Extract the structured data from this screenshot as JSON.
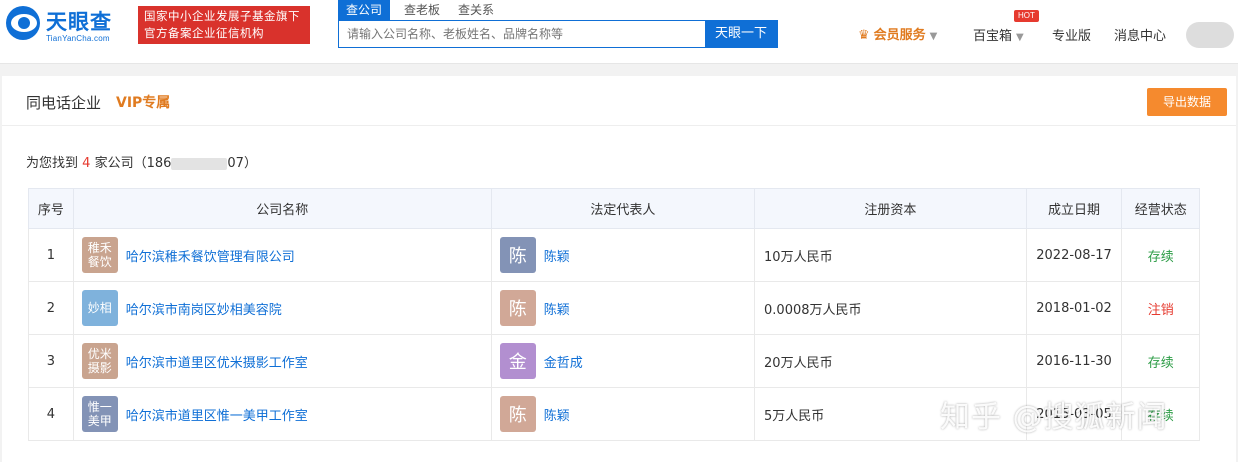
{
  "header": {
    "logo_text": "天眼查",
    "logo_sub": "TianYanCha.com",
    "gov_line1": "国家中小企业发展子基金旗下",
    "gov_line2": "官方备案企业征信机构",
    "search_tabs": [
      {
        "label": "查公司"
      },
      {
        "label": "查老板"
      },
      {
        "label": "查关系"
      }
    ],
    "search_placeholder": "请输入公司名称、老板姓名、品牌名称等",
    "search_button": "天眼一下",
    "vip_service": "会员服务",
    "treasure_box": "百宝箱",
    "hot_badge": "HOT",
    "pro_version": "专业版",
    "message_center": "消息中心"
  },
  "panel": {
    "title": "同电话企业",
    "vip_tag": "VIP专属",
    "export_button": "导出数据",
    "result_prefix": "为您找到",
    "result_count": "4",
    "result_suffix": "家公司（186",
    "result_phone_tail": "07）"
  },
  "table": {
    "headers": [
      "序号",
      "公司名称",
      "法定代表人",
      "注册资本",
      "成立日期",
      "经营状态"
    ],
    "rows": [
      {
        "idx": "1",
        "logo_text": "稚禾\n餐饮",
        "logo_color": "#c9a48f",
        "name": "哈尔滨稚禾餐饮管理有限公司",
        "rep_char": "陈",
        "rep_color": "#8393b6",
        "rep": "陈颖",
        "capital": "10万人民币",
        "date": "2022-08-17",
        "status": "存续",
        "status_type": "active"
      },
      {
        "idx": "2",
        "logo_text": "妙相",
        "logo_color": "#7fb2dc",
        "name": "哈尔滨市南岗区妙相美容院",
        "rep_char": "陈",
        "rep_color": "#d1a897",
        "rep": "陈颖",
        "capital": "0.0008万人民币",
        "date": "2018-01-02",
        "status": "注销",
        "status_type": "cancel"
      },
      {
        "idx": "3",
        "logo_text": "优米\n摄影",
        "logo_color": "#c9a48f",
        "name": "哈尔滨市道里区优米摄影工作室",
        "rep_char": "金",
        "rep_color": "#b28fd0",
        "rep": "金哲成",
        "capital": "20万人民币",
        "date": "2016-11-30",
        "status": "存续",
        "status_type": "active"
      },
      {
        "idx": "4",
        "logo_text": "惟一\n美甲",
        "logo_color": "#8393b6",
        "name": "哈尔滨市道里区惟一美甲工作室",
        "rep_char": "陈",
        "rep_color": "#d1a897",
        "rep": "陈颖",
        "capital": "5万人民币",
        "date": "2015-03-05",
        "status": "存续",
        "status_type": "active"
      }
    ]
  },
  "watermark": "知乎 @搜狐新闻"
}
